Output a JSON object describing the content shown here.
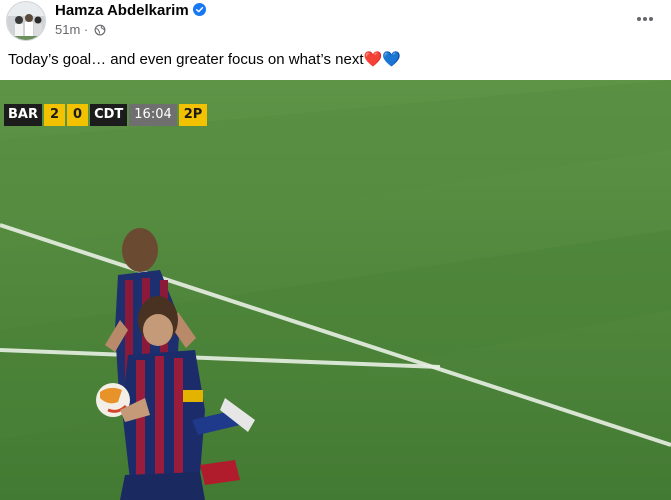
{
  "post": {
    "author": "Hamza Abdelkarim",
    "time": "51m",
    "separator": "·",
    "caption": "Today’s goal… and even greater focus on what’s next❤️💙"
  },
  "video": {
    "scorebug": {
      "home_team": "BAR",
      "home_score": "2",
      "away_score": "0",
      "away_team": "CDT",
      "clock": "16:04",
      "period": "2P"
    }
  },
  "icons": {
    "verified": "verified-badge-icon",
    "audience": "globe-icon",
    "more": "more-horizontal-icon"
  },
  "colors": {
    "verified_blue": "#1877f2",
    "scorebug_yellow": "#f2c200",
    "pitch_green": "#4f8a3a"
  }
}
